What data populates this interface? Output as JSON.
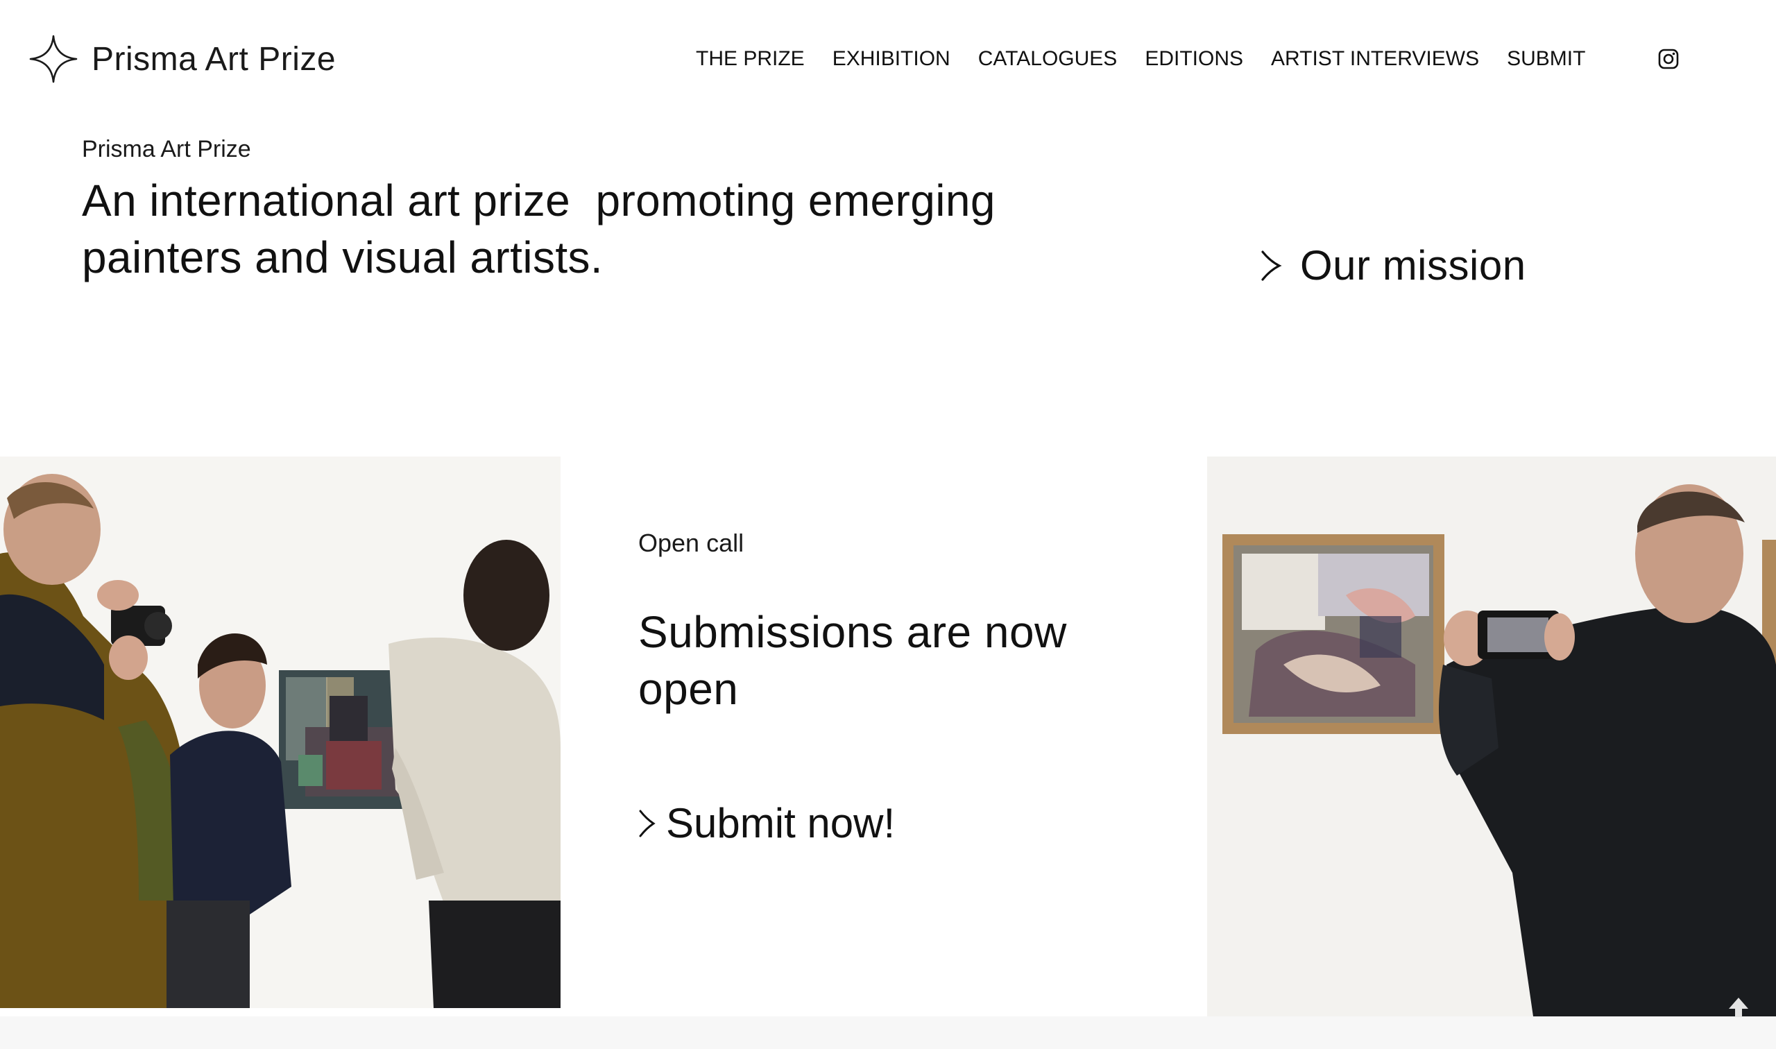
{
  "brand": {
    "name": "Prisma Art Prize",
    "logo_icon": "four-point-star-icon"
  },
  "nav": {
    "items": [
      {
        "label": "THE PRIZE"
      },
      {
        "label": "EXHIBITION"
      },
      {
        "label": "CATALOGUES"
      },
      {
        "label": "EDITIONS"
      },
      {
        "label": "ARTIST INTERVIEWS"
      },
      {
        "label": "SUBMIT"
      }
    ],
    "social_icon": "instagram-icon"
  },
  "hero": {
    "eyebrow": "Prisma Art Prize",
    "tagline": "An international art prize  promoting emerging painters and visual artists.",
    "mission_link": "Our mission",
    "link_icon": "chevron-right-icon"
  },
  "open_call": {
    "label": "Open call",
    "headline": "Submissions are now open",
    "cta": "Submit now!"
  },
  "images": {
    "left": "gallery-visitors-photographing-painting",
    "right": "visitor-photographing-framed-painting"
  },
  "colors": {
    "text": "#111111",
    "background": "#ffffff",
    "footer": "#f7f7f7"
  },
  "utility": {
    "back_to_top_icon": "arrow-up-icon"
  }
}
